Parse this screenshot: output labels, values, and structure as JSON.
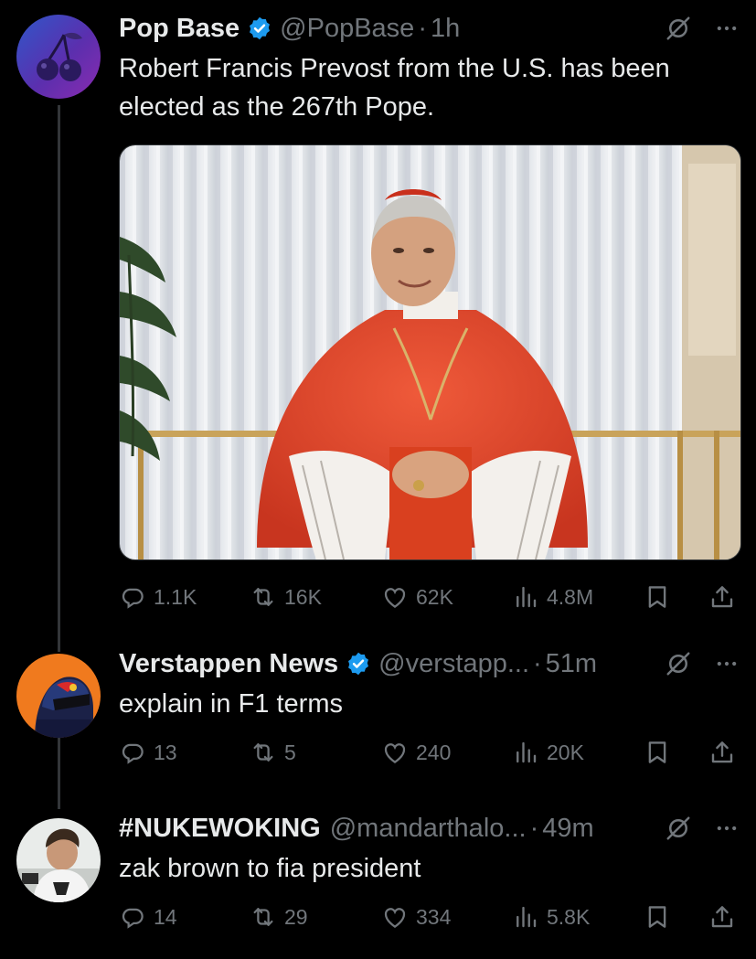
{
  "tweets": [
    {
      "name": "Pop Base",
      "handle": "@PopBase",
      "separator": "·",
      "time": "1h",
      "text": "Robert Francis Prevost from the U.S. has been elected as the 267th Pope.",
      "icons": {
        "verified": "verified-badge-icon",
        "grok": "grok-icon",
        "more": "more-icon"
      },
      "stats": {
        "replies": "1.1K",
        "reposts": "16K",
        "likes": "62K",
        "views": "4.8M"
      }
    },
    {
      "name": "Verstappen News",
      "handle": "@verstapp...",
      "separator": "·",
      "time": "51m",
      "text": "explain in F1 terms",
      "stats": {
        "replies": "13",
        "reposts": "5",
        "likes": "240",
        "views": "20K"
      }
    },
    {
      "name": "#NUKEWOKING",
      "handle": "@mandarthalo...",
      "separator": "·",
      "time": "49m",
      "text": "zak brown to fia president",
      "stats": {
        "replies": "14",
        "reposts": "29",
        "likes": "334",
        "views": "5.8K"
      }
    }
  ],
  "colors": {
    "background": "#000000",
    "text": "#e7e9ea",
    "muted": "#71767b",
    "verified": "#1d9bf0",
    "thread_line": "#333639"
  }
}
